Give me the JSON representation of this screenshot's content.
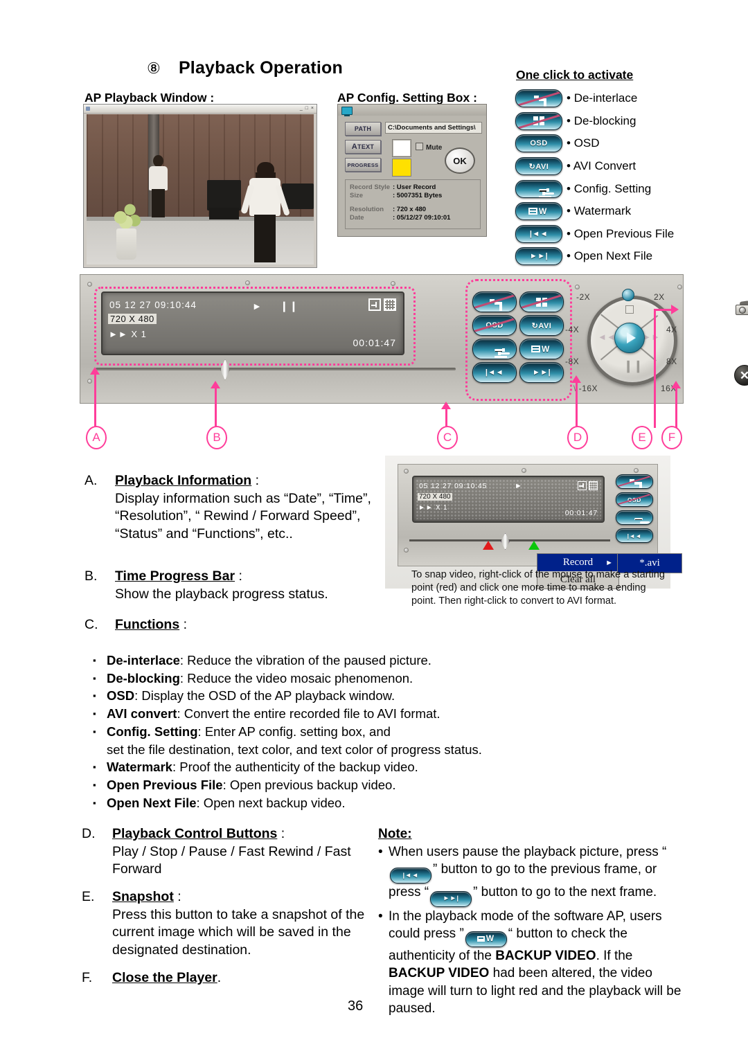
{
  "page": {
    "heading_marker": "⑧",
    "heading": "Playback Operation",
    "page_number": "36"
  },
  "captions": {
    "ap_playback_window": "AP Playback Window :",
    "ap_config_setting_box": "AP Config. Setting Box :",
    "one_click_to_activate": "One click to activate"
  },
  "config_box": {
    "path_button": "PATH",
    "text_button": "TEXT",
    "text_button_prefix": "A",
    "progress_button": "PROGRESS",
    "path_value": "C:\\Documents and Settings\\",
    "mute_label": "Mute",
    "ok_label": "OK",
    "info": [
      {
        "key": "Record Style",
        "value": ": User Record"
      },
      {
        "key": "Size",
        "value": ": 5007351 Bytes"
      },
      {
        "key": "Resolution",
        "value": ": 720 x 480"
      },
      {
        "key": "Date",
        "value": ": 05/12/27  09:10:01"
      }
    ],
    "swatch_text_color": "#ffffff",
    "swatch_progress_color": "#ffe000"
  },
  "legend": [
    {
      "icon": "de-interlace-icon",
      "label": "De-interlace"
    },
    {
      "icon": "de-blocking-icon",
      "label": "De-blocking"
    },
    {
      "icon": "osd-icon",
      "label": "OSD",
      "glyph": "OSD"
    },
    {
      "icon": "avi-convert-icon",
      "label": "AVI Convert",
      "glyph": "AVI"
    },
    {
      "icon": "config-setting-icon",
      "label": "Config. Setting"
    },
    {
      "icon": "watermark-icon",
      "label": "Watermark",
      "glyph": "W"
    },
    {
      "icon": "open-previous-file-icon",
      "label": "Open Previous File",
      "glyph": "|◄◄"
    },
    {
      "icon": "open-next-file-icon",
      "label": "Open Next File",
      "glyph": "►►|"
    }
  ],
  "player": {
    "lcd": {
      "datetime": "05  12  27     09:10:44",
      "resolution": "720 X 480",
      "speed": "►► X 1",
      "elapsed": "00:01:47"
    },
    "jog_labels": [
      "-2X",
      "2X",
      "-4X",
      "4X",
      "-8X",
      "8X",
      "-16X",
      "16X"
    ],
    "callouts": [
      "A",
      "B",
      "C",
      "D",
      "E",
      "F"
    ]
  },
  "sections": {
    "A": {
      "letter": "A.",
      "heading": "Playback Information",
      "colon": ":",
      "body": "Display information such as “Date”, “Time”, “Resolution”, “ Rewind / Forward Speed”, “Status” and “Functions”, etc.."
    },
    "B": {
      "letter": "B.",
      "heading": "Time Progress Bar",
      "colon": ":",
      "body": "Show the playback progress status."
    },
    "C": {
      "letter": "C.",
      "heading": "Functions",
      "colon": ":"
    },
    "D": {
      "letter": "D.",
      "heading": "Playback Control Buttons",
      "colon": ":",
      "body": "Play / Stop / Pause / Fast Rewind / Fast Forward"
    },
    "E": {
      "letter": "E.",
      "heading": "Snapshot",
      "colon": ":",
      "body": "Press this button to take a snapshot of the current image which will be saved in the designated destination."
    },
    "F": {
      "letter": "F.",
      "heading": "Close the Player",
      "period": "."
    }
  },
  "function_bullets": [
    {
      "term": "De-interlace",
      "desc": ": Reduce the vibration of the paused picture."
    },
    {
      "term": "De-blocking",
      "desc": ": Reduce the video mosaic phenomenon."
    },
    {
      "term": "OSD",
      "desc": ": Display the OSD of the AP playback window."
    },
    {
      "term": "AVI convert",
      "desc": ": Convert the entire recorded file to AVI format."
    },
    {
      "term": "Config. Setting",
      "desc": ": Enter AP config. setting box, and",
      "continuation": "set the file destination, text color, and text color of progress status."
    },
    {
      "term": "Watermark",
      "desc": ": Proof the authenticity of the backup video."
    },
    {
      "term": "Open Previous File",
      "desc": ": Open previous backup video."
    },
    {
      "term": "Open Next File",
      "desc": ": Open next backup video."
    }
  ],
  "snapshot_figure": {
    "lcd": {
      "datetime": "05  12  27    09:10:45",
      "resolution": "720 X 480",
      "speed": "►► X 1",
      "elapsed": "00:01:47"
    },
    "context_menu": {
      "record": "Record",
      "record_arrow": "►",
      "clear_all": "Clear all",
      "submenu": "*.avi"
    },
    "caption": "To snap video, right-click of the mouse to make a starting point (red) and click one more time to make a ending point.  Then right-click to convert to AVI format.",
    "marker_start_color": "#e11b1b",
    "marker_end_color": "#0ac70a"
  },
  "note": {
    "title": "Note:",
    "item1_a": "When users pause the playback picture, press “",
    "item1_b": "” button to go to the previous frame, or press “",
    "item1_c": "” button to go to the next frame.",
    "item2_a": "In the playback mode of the software AP, users could press ”",
    "item2_b": "“ button to check the authenticity of the ",
    "item2_bold1": "BACKUP VIDEO",
    "item2_c": ". If the ",
    "item2_bold2": "BACKUP VIDEO",
    "item2_d": " had been altered, the video image will turn to light red and the playback will be paused."
  },
  "colors": {
    "callout_pink": "#ff3d9a",
    "menu_blue": "#00218a",
    "pill_cyan": "#2e8ea8"
  }
}
